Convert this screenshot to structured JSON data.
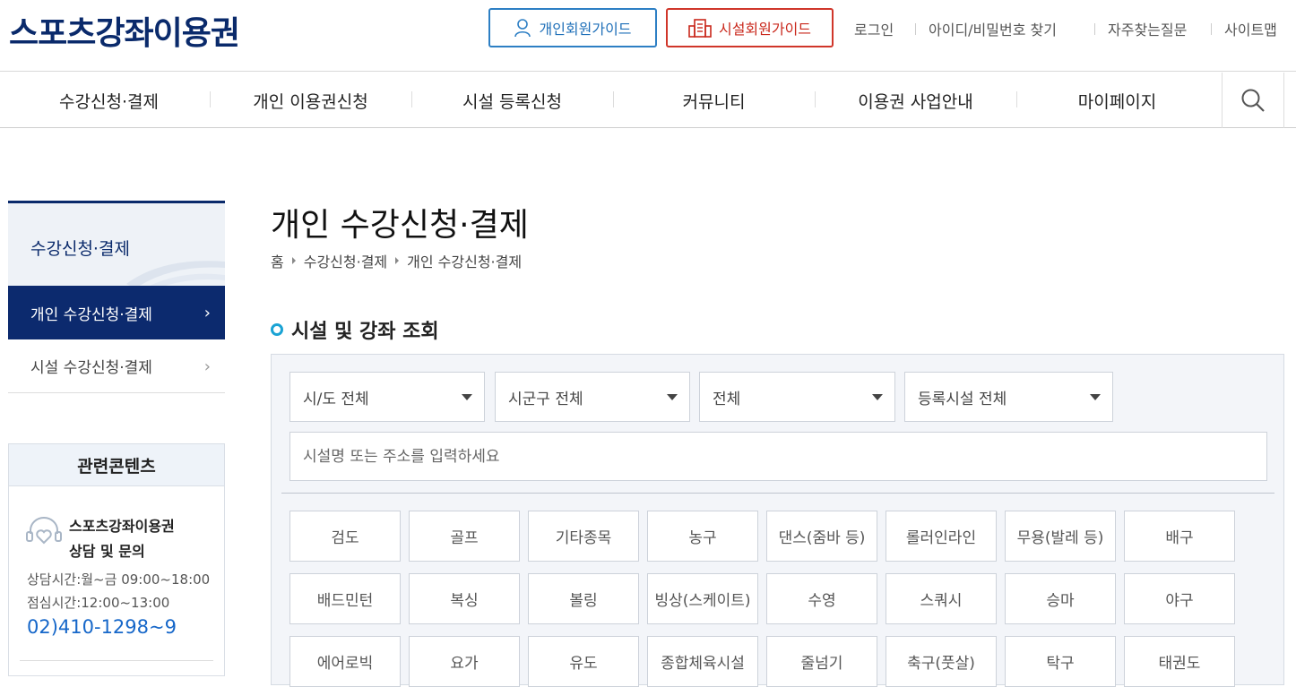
{
  "header": {
    "logo": "스포츠강좌이용권",
    "personal_guide": "개인회원가이드",
    "facility_guide": "시설회원가이드",
    "util_links": [
      "로그인",
      "아이디/비밀번호 찾기",
      "자주찾는질문",
      "사이트맵"
    ]
  },
  "gnb": {
    "items": [
      "수강신청·결제",
      "개인 이용권신청",
      "시설 등록신청",
      "커뮤니티",
      "이용권 사업안내",
      "마이페이지"
    ],
    "search_icon": "search-icon"
  },
  "lnb": {
    "title": "수강신청·결제",
    "items": [
      "개인 수강신청·결제",
      "시설 수강신청·결제"
    ]
  },
  "related": {
    "title": "관련콘텐츠",
    "name_line1": "스포츠강좌이용권",
    "name_line2": "상담 및 문의",
    "hours": "상담시간:월~금 09:00~18:00",
    "lunch": "점심시간:12:00~13:00",
    "phone": "02)410-1298~9"
  },
  "main": {
    "title": "개인 수강신청·결제",
    "breadcrumb": [
      "홈",
      "수강신청·결제",
      "개인 수강신청·결제"
    ],
    "section_title": "시설 및 강좌 조회",
    "selects": [
      "시/도 전체",
      "시군구 전체",
      "전체",
      "등록시설 전체"
    ],
    "search_placeholder": "시설명 또는 주소를 입력하세요",
    "sports": [
      "검도",
      "골프",
      "기타종목",
      "농구",
      "댄스(줌바 등)",
      "롤러인라인",
      "무용(발레 등)",
      "배구",
      "배드민턴",
      "복싱",
      "볼링",
      "빙상(스케이트)",
      "수영",
      "스쿼시",
      "승마",
      "야구",
      "에어로빅",
      "요가",
      "유도",
      "종합체육시설",
      "줄넘기",
      "축구(풋살)",
      "탁구",
      "태권도"
    ]
  },
  "colors": {
    "brand_navy": "#0a2a6b",
    "personal_blue": "#2d7fc4",
    "facility_red": "#d0362a",
    "accent_cyan": "#1aa3d4",
    "phone_blue": "#1667c9"
  }
}
